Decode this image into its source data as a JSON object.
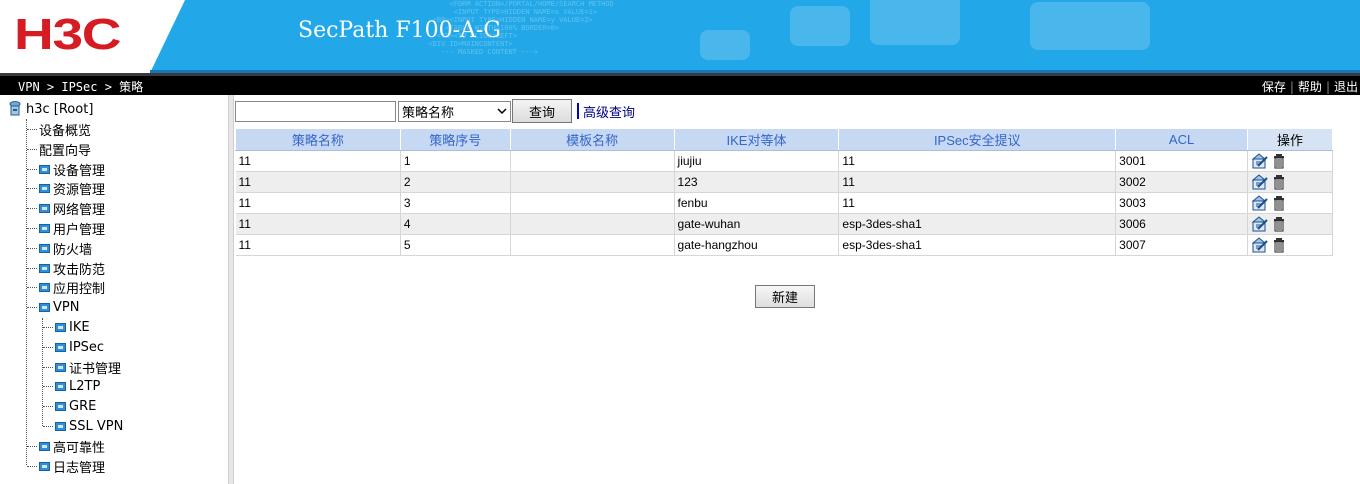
{
  "header": {
    "brand": "H3C",
    "product": "SecPath F100-A-G",
    "colors": {
      "brand_red": "#d61c22",
      "banner_blue": "#22a8e8"
    }
  },
  "topbar": {
    "breadcrumb": "VPN > IPSec > 策略",
    "save": "保存",
    "help": "帮助",
    "logout": "退出"
  },
  "sidebar": {
    "root": "h3c [Root]",
    "items": [
      {
        "label": "设备概览",
        "folder": false,
        "level": 1
      },
      {
        "label": "配置向导",
        "folder": false,
        "level": 1
      },
      {
        "label": "设备管理",
        "folder": true,
        "level": 1
      },
      {
        "label": "资源管理",
        "folder": true,
        "level": 1
      },
      {
        "label": "网络管理",
        "folder": true,
        "level": 1
      },
      {
        "label": "用户管理",
        "folder": true,
        "level": 1
      },
      {
        "label": "防火墙",
        "folder": true,
        "level": 1
      },
      {
        "label": "攻击防范",
        "folder": true,
        "level": 1
      },
      {
        "label": "应用控制",
        "folder": true,
        "level": 1
      },
      {
        "label": "VPN",
        "folder": true,
        "level": 1
      },
      {
        "label": "IKE",
        "folder": true,
        "level": 2
      },
      {
        "label": "IPSec",
        "folder": true,
        "level": 2
      },
      {
        "label": "证书管理",
        "folder": true,
        "level": 2
      },
      {
        "label": "L2TP",
        "folder": true,
        "level": 2
      },
      {
        "label": "GRE",
        "folder": true,
        "level": 2
      },
      {
        "label": "SSL VPN",
        "folder": true,
        "level": 2
      },
      {
        "label": "高可靠性",
        "folder": true,
        "level": 1
      },
      {
        "label": "日志管理",
        "folder": true,
        "level": 1
      }
    ]
  },
  "search": {
    "value": "",
    "selected_field": "策略名称",
    "query_label": "查询",
    "advanced_label": "高级查询"
  },
  "table": {
    "columns": [
      "策略名称",
      "策略序号",
      "模板名称",
      "IKE对等体",
      "IPSec安全提议",
      "ACL",
      "操作"
    ],
    "rows": [
      [
        "11",
        "1",
        "",
        "jiujiu",
        "11",
        "3001"
      ],
      [
        "11",
        "2",
        "",
        "123",
        "11",
        "3002"
      ],
      [
        "11",
        "3",
        "",
        "fenbu",
        "11",
        "3003"
      ],
      [
        "11",
        "4",
        "",
        "gate-wuhan",
        "esp-3des-sha1",
        "3006"
      ],
      [
        "11",
        "5",
        "",
        "gate-hangzhou",
        "esp-3des-sha1",
        "3007"
      ]
    ],
    "row_icons": [
      "edit-icon",
      "delete-icon"
    ]
  },
  "actions": {
    "new_label": "新建"
  }
}
